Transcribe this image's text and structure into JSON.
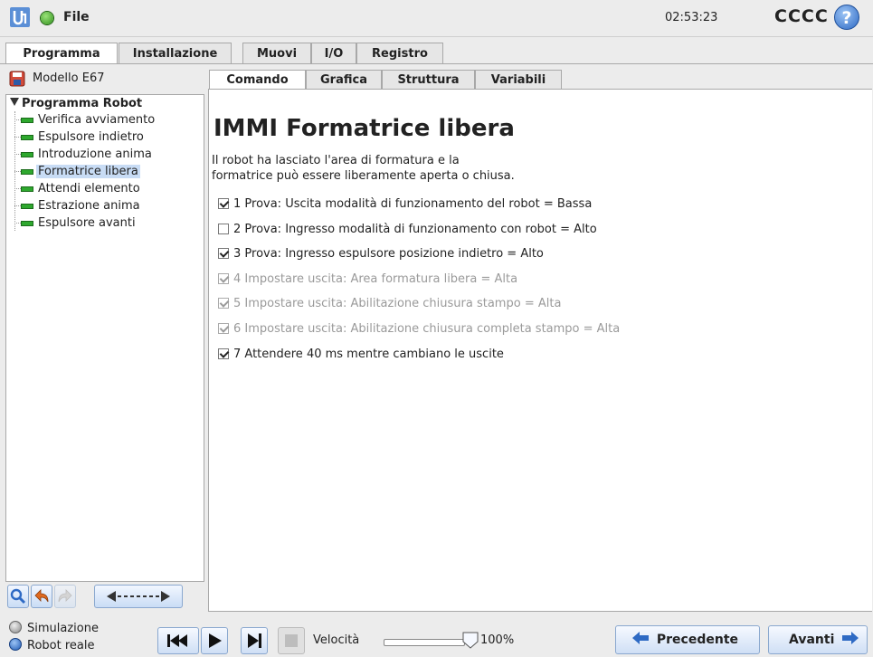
{
  "header": {
    "menu_label": "File",
    "clock": "02:53:23",
    "robot_name": "CCCC",
    "help_glyph": "?"
  },
  "main_tabs": [
    {
      "label": "Programma",
      "active": true
    },
    {
      "label": "Installazione",
      "active": false
    },
    {
      "label": "Muovi",
      "active": false
    },
    {
      "label": "I/O",
      "active": false
    },
    {
      "label": "Registro",
      "active": false
    }
  ],
  "sidebar": {
    "model_name": "Modello E67",
    "tree_root": "Programma Robot",
    "items": [
      {
        "label": "Verifica avviamento",
        "selected": false
      },
      {
        "label": "Espulsore indietro",
        "selected": false
      },
      {
        "label": "Introduzione anima",
        "selected": false
      },
      {
        "label": "Formatrice libera",
        "selected": true
      },
      {
        "label": "Attendi elemento",
        "selected": false
      },
      {
        "label": "Estrazione anima",
        "selected": false
      },
      {
        "label": "Espulsore avanti",
        "selected": false
      }
    ]
  },
  "sub_tabs": [
    {
      "label": "Comando",
      "active": true
    },
    {
      "label": "Grafica",
      "active": false
    },
    {
      "label": "Struttura",
      "active": false
    },
    {
      "label": "Variabili",
      "active": false
    }
  ],
  "command": {
    "title": "IMMI Formatrice libera",
    "description_line1": "Il robot ha lasciato l'area di formatura e la",
    "description_line2": "formatrice può essere liberamente aperta o chiusa.",
    "checks": [
      {
        "label": "1 Prova: Uscita modalità di funzionamento del robot = Bassa",
        "checked": true,
        "enabled": true
      },
      {
        "label": "2 Prova: Ingresso modalità di funzionamento con robot = Alto",
        "checked": false,
        "enabled": true
      },
      {
        "label": "3 Prova: Ingresso espulsore posizione indietro = Alto",
        "checked": true,
        "enabled": true
      },
      {
        "label": "4 Impostare uscita: Area formatura libera = Alta",
        "checked": true,
        "enabled": false
      },
      {
        "label": "5 Impostare uscita: Abilitazione chiusura stampo = Alta",
        "checked": true,
        "enabled": false
      },
      {
        "label": "6 Impostare uscita: Abilitazione chiusura completa stampo = Alta",
        "checked": true,
        "enabled": false
      },
      {
        "label": "7 Attendere 40 ms mentre cambiano le uscite",
        "checked": true,
        "enabled": true
      }
    ]
  },
  "footer": {
    "mode_simulation": "Simulazione",
    "mode_real": "Robot reale",
    "speed_label": "Velocità",
    "speed_value": "100%",
    "speed_fraction": 1.0,
    "prev_label": "Precedente",
    "next_label": "Avanti"
  },
  "colors": {
    "accent_blue": "#2e6ac4",
    "status_green": "#2f8f1a",
    "selection": "#c8dcf5",
    "node_green": "#2ea82e"
  }
}
